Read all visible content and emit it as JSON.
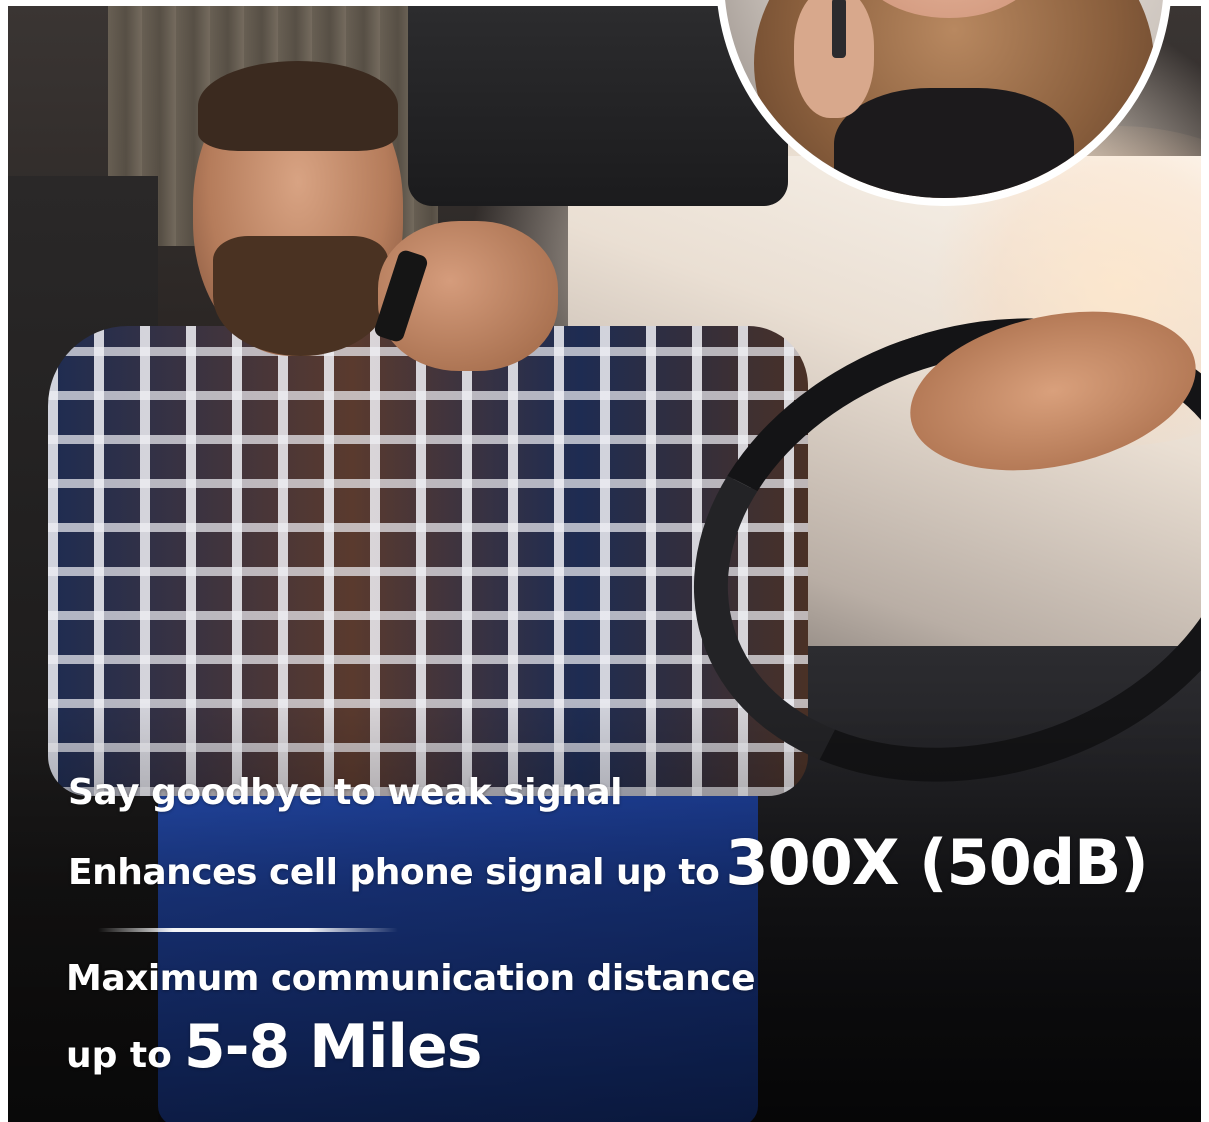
{
  "headline": "Say goodbye to weak signal",
  "boost": {
    "lead": "Enhances cell phone signal up to",
    "value": "300X (50dB)"
  },
  "distance": {
    "heading": "Maximum communication distance",
    "lead": "up to",
    "value": "5-8 Miles"
  },
  "colors": {
    "text": "#ffffff",
    "overalls": "#2146a8",
    "inset_border": "#ffffff"
  }
}
